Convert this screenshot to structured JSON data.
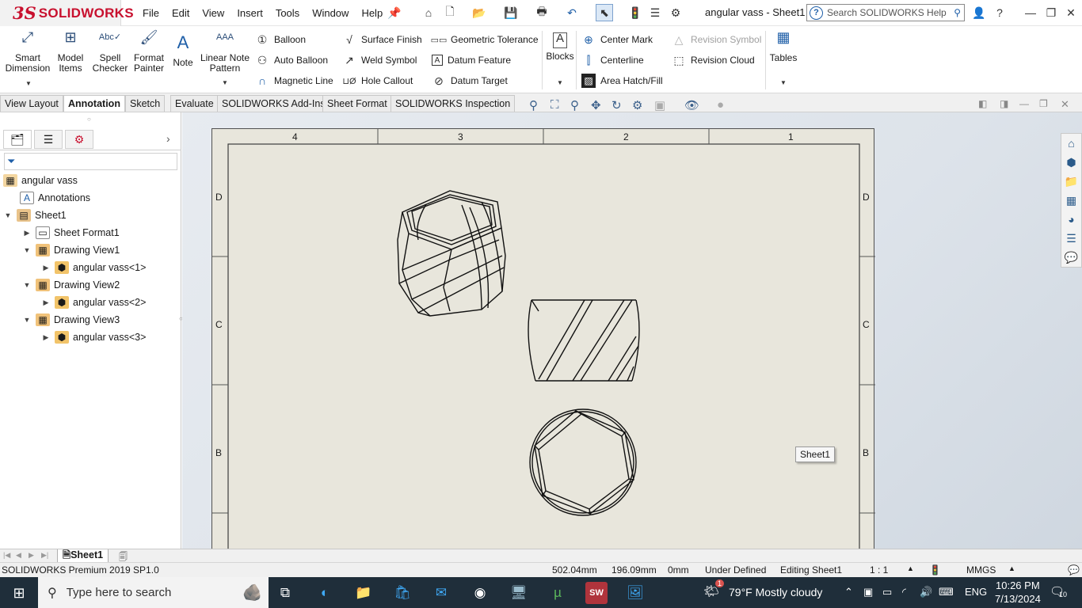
{
  "app": {
    "brand": "SOLIDWORKS",
    "doc_title": "angular vass - Sheet1 *",
    "brand_color": "#c8102e"
  },
  "menu": [
    "File",
    "Edit",
    "View",
    "Insert",
    "Tools",
    "Window",
    "Help"
  ],
  "search": {
    "placeholder": "Search SOLIDWORKS Help"
  },
  "ribbon": {
    "smart_dimension": [
      "Smart",
      "Dimension"
    ],
    "model_items": [
      "Model",
      "Items"
    ],
    "spell_checker": [
      "Spell",
      "Checker"
    ],
    "format_painter": [
      "Format",
      "Painter"
    ],
    "note": "Note",
    "linear_note_pattern": [
      "Linear Note",
      "Pattern"
    ],
    "balloon": "Balloon",
    "auto_balloon": "Auto Balloon",
    "magnetic_line": "Magnetic Line",
    "surface_finish": "Surface Finish",
    "weld_symbol": "Weld Symbol",
    "hole_callout": "Hole Callout",
    "geometric_tolerance": "Geometric Tolerance",
    "datum_feature": "Datum Feature",
    "datum_target": "Datum Target",
    "blocks": "Blocks",
    "center_mark": "Center Mark",
    "centerline": "Centerline",
    "area_hatch": "Area Hatch/Fill",
    "revision_symbol": "Revision Symbol",
    "revision_cloud": "Revision Cloud",
    "tables": "Tables"
  },
  "tabs": [
    "View Layout",
    "Annotation",
    "Sketch",
    "Evaluate",
    "SOLIDWORKS Add-Ins",
    "Sheet Format",
    "SOLIDWORKS Inspection"
  ],
  "active_tab": "Annotation",
  "tree": {
    "root": "angular vass",
    "annotations": "Annotations",
    "sheet": "Sheet1",
    "sheet_format": "Sheet Format1",
    "view1": "Drawing View1",
    "part1": "angular vass<1>",
    "view2": "Drawing View2",
    "part2": "angular vass<2>",
    "view3": "Drawing View3",
    "part3": "angular vass<3>"
  },
  "sheet": {
    "col_labels": [
      "4",
      "3",
      "2",
      "1"
    ],
    "row_labels": [
      "D",
      "C",
      "B"
    ],
    "label": "Sheet1"
  },
  "sheet_tab": "Sheet1",
  "status": {
    "product": "SOLIDWORKS Premium 2019 SP1.0",
    "x": "502.04mm",
    "y": "196.09mm",
    "z": "0mm",
    "state": "Under Defined",
    "editing": "Editing Sheet1",
    "scale": "1 : 1",
    "units": "MMGS"
  },
  "taskbar": {
    "search_placeholder": "Type here to search",
    "weather": "79°F  Mostly cloudy",
    "lang": "ENG",
    "time": "10:26 PM",
    "date": "7/13/2024",
    "notifications": "10",
    "weather_badge": "1"
  }
}
